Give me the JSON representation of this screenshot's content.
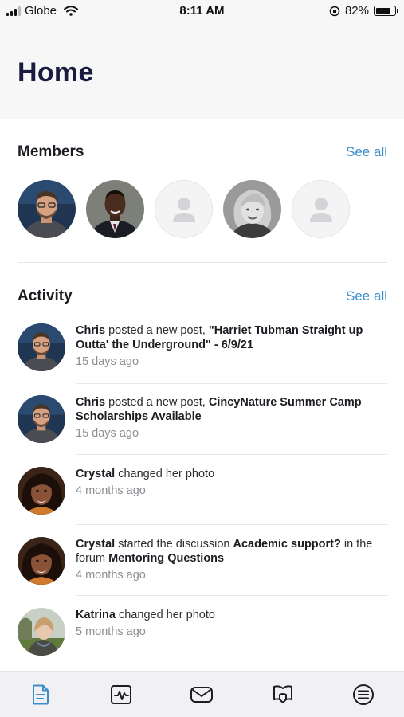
{
  "status_bar": {
    "carrier": "Globe",
    "time": "8:11 AM",
    "battery": "82%",
    "battery_level": 0.82
  },
  "header": {
    "title": "Home"
  },
  "members": {
    "title": "Members",
    "see_all": "See all",
    "avatars": [
      "avatar-man-glasses",
      "avatar-man-suit",
      "avatar-placeholder",
      "avatar-woman-blonde",
      "avatar-placeholder"
    ]
  },
  "activity": {
    "title": "Activity",
    "see_all": "See all",
    "items": [
      {
        "actor": "Chris",
        "action": " posted a new post, ",
        "object": "\"Harriet Tubman Straight up Outta' the Underground\" - 6/9/21",
        "suffix": "",
        "object2": "",
        "time": "15 days ago"
      },
      {
        "actor": "Chris",
        "action": " posted a new post, ",
        "object": "CincyNature Summer Camp Scholarships Available",
        "suffix": "",
        "object2": "",
        "time": "15 days ago"
      },
      {
        "actor": "Crystal",
        "action": " changed her photo",
        "object": "",
        "suffix": "",
        "object2": "",
        "time": "4 months ago"
      },
      {
        "actor": "Crystal",
        "action": " started the discussion ",
        "object": "Academic support?",
        "suffix": " in the forum ",
        "object2": "Mentoring Questions",
        "time": "4 months ago"
      },
      {
        "actor": "Katrina",
        "action": " changed her photo",
        "object": "",
        "suffix": "",
        "object2": "",
        "time": "5 months ago"
      }
    ]
  },
  "tab_bar": {
    "tabs": [
      "document-icon",
      "activity-pulse-icon",
      "mail-icon",
      "forum-icon",
      "menu-list-icon"
    ],
    "active_color": "#3a8ec9",
    "inactive_color": "#1c1c22"
  }
}
